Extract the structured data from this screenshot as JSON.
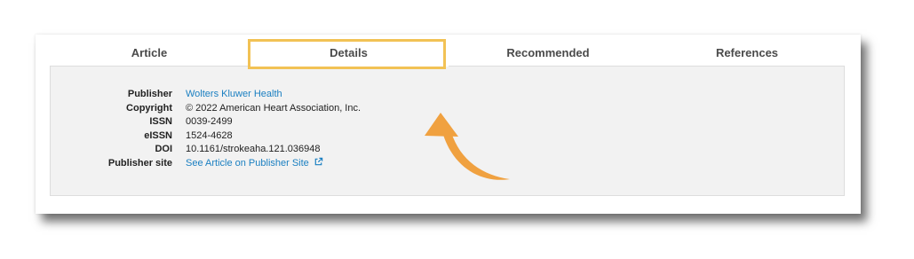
{
  "tabs": [
    {
      "label": "Article"
    },
    {
      "label": "Details"
    },
    {
      "label": "Recommended"
    },
    {
      "label": "References"
    }
  ],
  "details": {
    "publisher": {
      "label": "Publisher",
      "value": "Wolters Kluwer Health"
    },
    "copyright": {
      "label": "Copyright",
      "value": "© 2022 American Heart Association, Inc."
    },
    "issn": {
      "label": "ISSN",
      "value": "0039-2499"
    },
    "eissn": {
      "label": "eISSN",
      "value": "1524-4628"
    },
    "doi": {
      "label": "DOI",
      "value": "10.1161/strokeaha.121.036948"
    },
    "publisher_site": {
      "label": "Publisher site",
      "value": "See Article on Publisher Site"
    }
  },
  "icons": {
    "external_link": "external-link-icon",
    "annotation_arrow": "curved-arrow-icon"
  },
  "colors": {
    "highlight_box": "#f2c255",
    "arrow": "#f0a140",
    "link": "#1a7fc1",
    "panel_background": "#f2f2f2"
  }
}
